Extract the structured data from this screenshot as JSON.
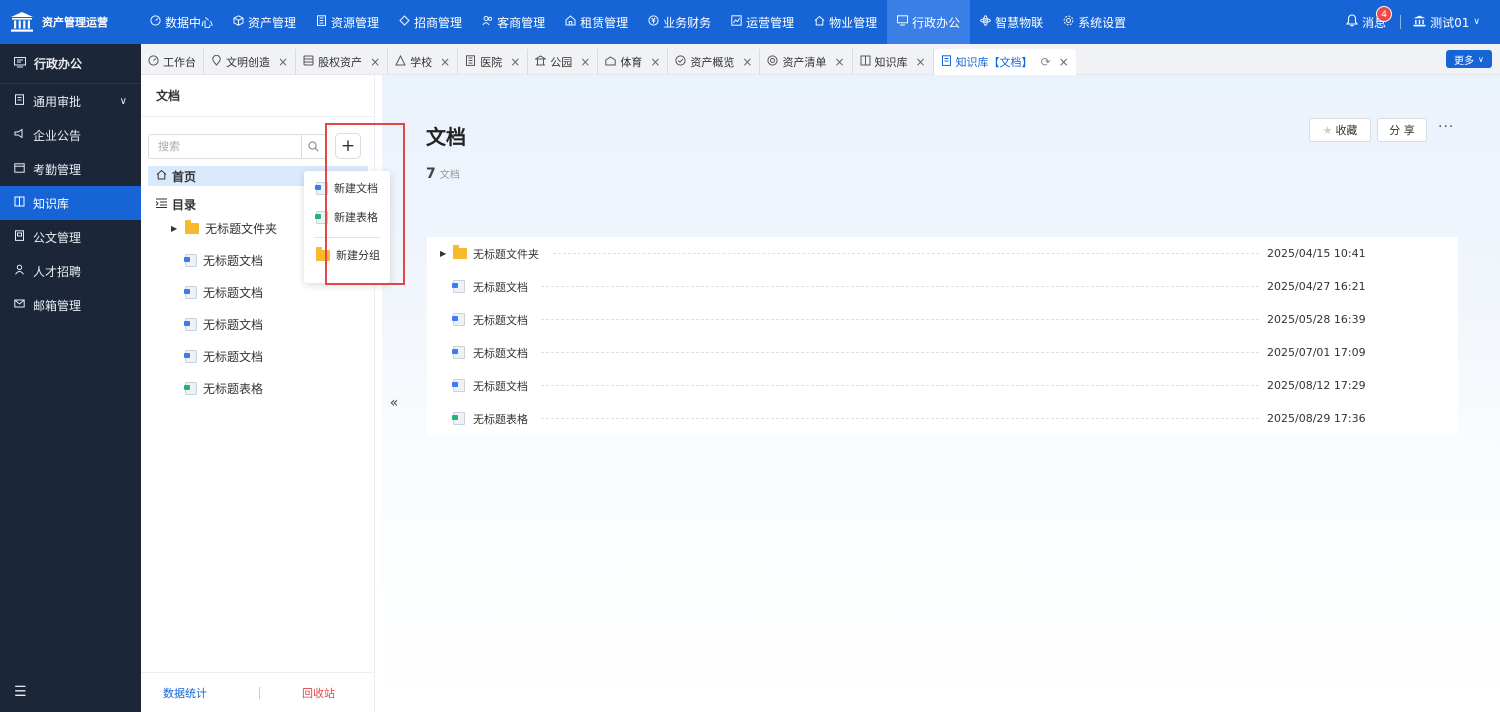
{
  "app": {
    "title": "资产管理运营"
  },
  "topnav": [
    {
      "label": "数据中心",
      "icon": "dashboard-icon"
    },
    {
      "label": "资产管理",
      "icon": "cube-icon"
    },
    {
      "label": "资源管理",
      "icon": "building-icon"
    },
    {
      "label": "招商管理",
      "icon": "diamond-icon"
    },
    {
      "label": "客商管理",
      "icon": "people-icon"
    },
    {
      "label": "租赁管理",
      "icon": "house-icon"
    },
    {
      "label": "业务财务",
      "icon": "money-icon"
    },
    {
      "label": "运营管理",
      "icon": "chart-icon"
    },
    {
      "label": "物业管理",
      "icon": "home-icon"
    },
    {
      "label": "行政办公",
      "icon": "monitor-icon",
      "active": true
    },
    {
      "label": "智慧物联",
      "icon": "atom-icon"
    },
    {
      "label": "系统设置",
      "icon": "gear-icon"
    }
  ],
  "header": {
    "messages_label": "消息",
    "messages_count": "4",
    "user_name": "测试01"
  },
  "sidebar": {
    "title": "行政办公",
    "items": [
      {
        "label": "通用审批",
        "icon": "approval-icon",
        "expandable": true
      },
      {
        "label": "企业公告",
        "icon": "megaphone-icon"
      },
      {
        "label": "考勤管理",
        "icon": "calendar-icon"
      },
      {
        "label": "知识库",
        "icon": "book-icon",
        "active": true
      },
      {
        "label": "公文管理",
        "icon": "document-icon"
      },
      {
        "label": "人才招聘",
        "icon": "person-icon"
      },
      {
        "label": "邮箱管理",
        "icon": "mail-icon"
      }
    ]
  },
  "tabs": [
    {
      "label": "工作台",
      "icon": "dashboard-icon",
      "closable": false
    },
    {
      "label": "文明创造",
      "icon": "pin-icon",
      "closable": true
    },
    {
      "label": "股权资产",
      "icon": "database-icon",
      "closable": true
    },
    {
      "label": "学校",
      "icon": "triangle-icon",
      "closable": true
    },
    {
      "label": "医院",
      "icon": "building-icon",
      "closable": true
    },
    {
      "label": "公园",
      "icon": "pavilion-icon",
      "closable": true
    },
    {
      "label": "体育",
      "icon": "sports-icon",
      "closable": true
    },
    {
      "label": "资产概览",
      "icon": "check-circle-icon",
      "closable": true
    },
    {
      "label": "资产清单",
      "icon": "target-icon",
      "closable": true
    },
    {
      "label": "知识库",
      "icon": "book-icon",
      "closable": true
    },
    {
      "label": "知识库【文档】",
      "icon": "doc-icon",
      "closable": true,
      "active": true
    }
  ],
  "more_label": "更多",
  "tree": {
    "title": "文档",
    "search_placeholder": "搜索",
    "home_label": "首页",
    "directory_label": "目录",
    "items": [
      {
        "name": "无标题文件夹",
        "type": "folder"
      },
      {
        "name": "无标题文档",
        "type": "doc"
      },
      {
        "name": "无标题文档",
        "type": "doc"
      },
      {
        "name": "无标题文档",
        "type": "doc"
      },
      {
        "name": "无标题文档",
        "type": "doc"
      },
      {
        "name": "无标题表格",
        "type": "sheet"
      }
    ],
    "stats_label": "数据统计",
    "recycle_label": "回收站"
  },
  "dropdown": {
    "items": [
      {
        "label": "新建文档",
        "type": "doc"
      },
      {
        "label": "新建表格",
        "type": "sheet"
      },
      {
        "label": "新建分组",
        "type": "folder"
      }
    ]
  },
  "main": {
    "title": "文档",
    "count": "7",
    "count_unit": "文档",
    "favorite_label": "收藏",
    "share_label": "分 享",
    "rows": [
      {
        "name": "无标题文件夹",
        "type": "folder",
        "time": "2025/04/15 10:41"
      },
      {
        "name": "无标题文档",
        "type": "doc",
        "time": "2025/04/27 16:21"
      },
      {
        "name": "无标题文档",
        "type": "doc",
        "time": "2025/05/28 16:39"
      },
      {
        "name": "无标题文档",
        "type": "doc",
        "time": "2025/07/01 17:09"
      },
      {
        "name": "无标题文档",
        "type": "doc",
        "time": "2025/08/12 17:29"
      },
      {
        "name": "无标题表格",
        "type": "sheet",
        "time": "2025/08/29 17:36"
      }
    ]
  },
  "colors": {
    "primary": "#1664d6",
    "sidebar_bg": "#1c2639",
    "danger": "#e54545",
    "folder": "#f7b92d",
    "sheet": "#22b573",
    "doc": "#3c7bf0"
  }
}
